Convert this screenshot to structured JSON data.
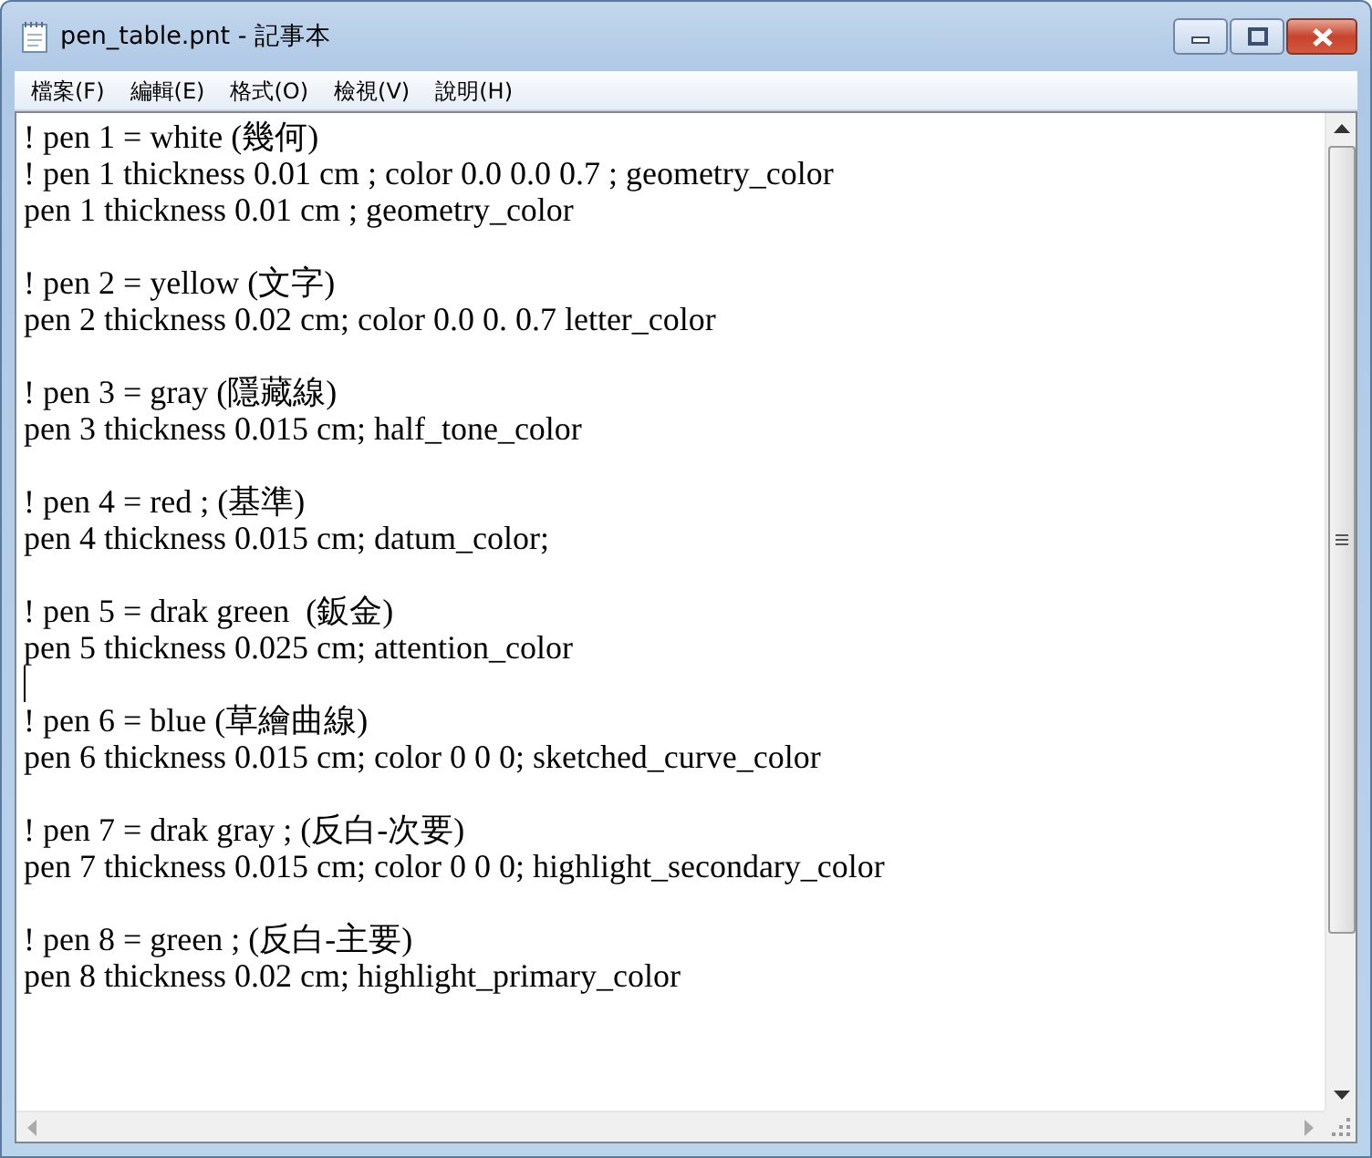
{
  "window": {
    "title": "pen_table.pnt - 記事本"
  },
  "menu": [
    "檔案(F)",
    "編輯(E)",
    "格式(O)",
    "檢視(V)",
    "說明(H)"
  ],
  "blocks": [
    {
      "lines": [
        "! pen 1 = white (幾何)",
        "! pen 1 thickness 0.01 cm ; color 0.0 0.0 0.7 ; geometry_color",
        "pen 1 thickness 0.01 cm ; geometry_color"
      ],
      "caret_after": false
    },
    {
      "lines": [
        "! pen 2 = yellow (文字)",
        "pen 2 thickness 0.02 cm; color 0.0 0. 0.7 letter_color"
      ],
      "caret_after": false
    },
    {
      "lines": [
        "! pen 3 = gray (隱藏線)",
        "pen 3 thickness 0.015 cm; half_tone_color"
      ],
      "caret_after": false
    },
    {
      "lines": [
        "! pen 4 = red ; (基準)",
        "pen 4 thickness 0.015 cm; datum_color;"
      ],
      "caret_after": false
    },
    {
      "lines": [
        "! pen 5 = drak green  (鈑金)",
        "pen 5 thickness 0.025 cm; attention_color"
      ],
      "caret_after": true
    },
    {
      "lines": [
        "! pen 6 = blue (草繪曲線)",
        "pen 6 thickness 0.015 cm; color 0 0 0; sketched_curve_color"
      ],
      "caret_after": false
    },
    {
      "lines": [
        "! pen 7 = drak gray ; (反白-次要)",
        "pen 7 thickness 0.015 cm; color 0 0 0; highlight_secondary_color"
      ],
      "caret_after": false
    },
    {
      "lines": [
        "! pen 8 = green ; (反白-主要)",
        "pen 8 thickness 0.02 cm; highlight_primary_color"
      ],
      "caret_after": false
    }
  ]
}
